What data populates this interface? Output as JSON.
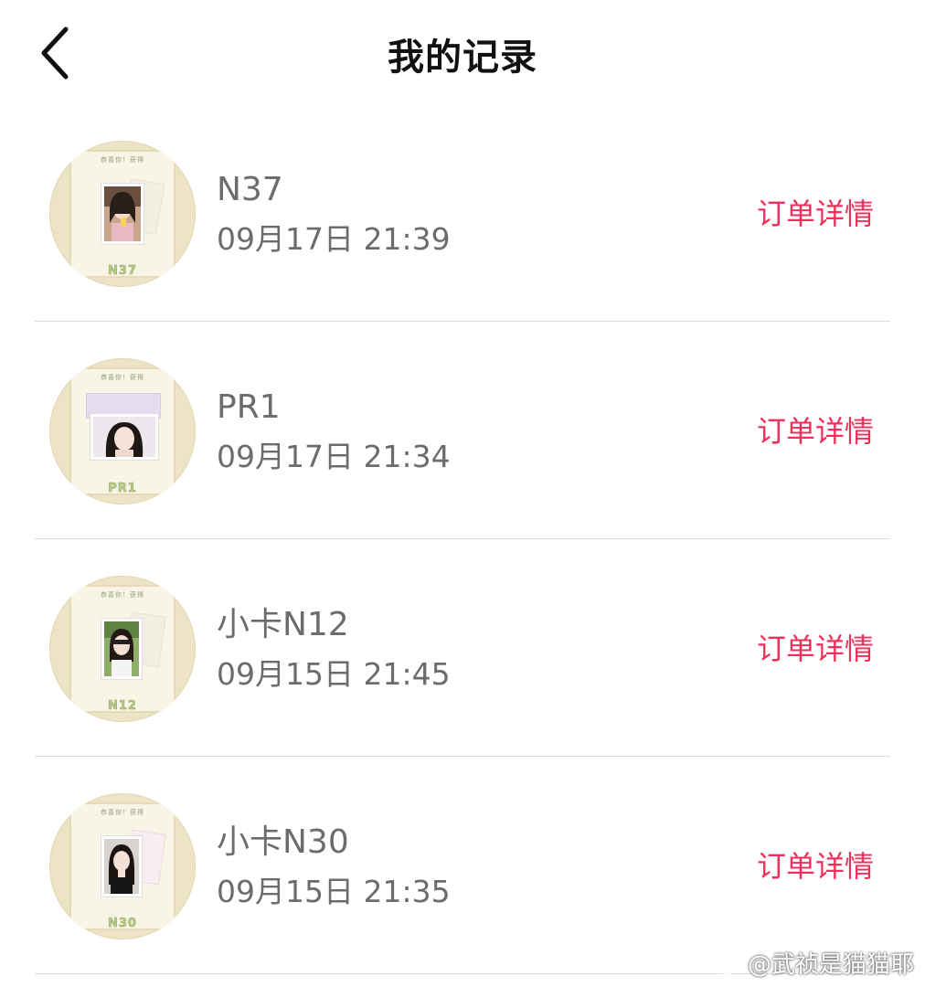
{
  "header": {
    "title": "我的记录",
    "back_icon": "chevron-left-icon"
  },
  "records": [
    {
      "name": "N37",
      "time": "09月17日  21:39",
      "detail_label": "订单详情",
      "thumb_code": "N37",
      "thumb_header": "恭喜你！获得"
    },
    {
      "name": "PR1",
      "time": "09月17日  21:34",
      "detail_label": "订单详情",
      "thumb_code": "PR1",
      "thumb_header": "恭喜你！获得"
    },
    {
      "name": "小卡N12",
      "time": "09月15日  21:45",
      "detail_label": "订单详情",
      "thumb_code": "N12",
      "thumb_header": "恭喜你！获得"
    },
    {
      "name": "小卡N30",
      "time": "09月15日  21:35",
      "detail_label": "订单详情",
      "thumb_code": "N30",
      "thumb_header": "恭喜你！获得"
    }
  ],
  "watermark": {
    "text": "@武祯是猫猫耶",
    "icon": "weibo-icon"
  },
  "colors": {
    "accent": "#f0305a",
    "text_secondary": "#6c6c6c",
    "divider": "#dcdcdc"
  }
}
